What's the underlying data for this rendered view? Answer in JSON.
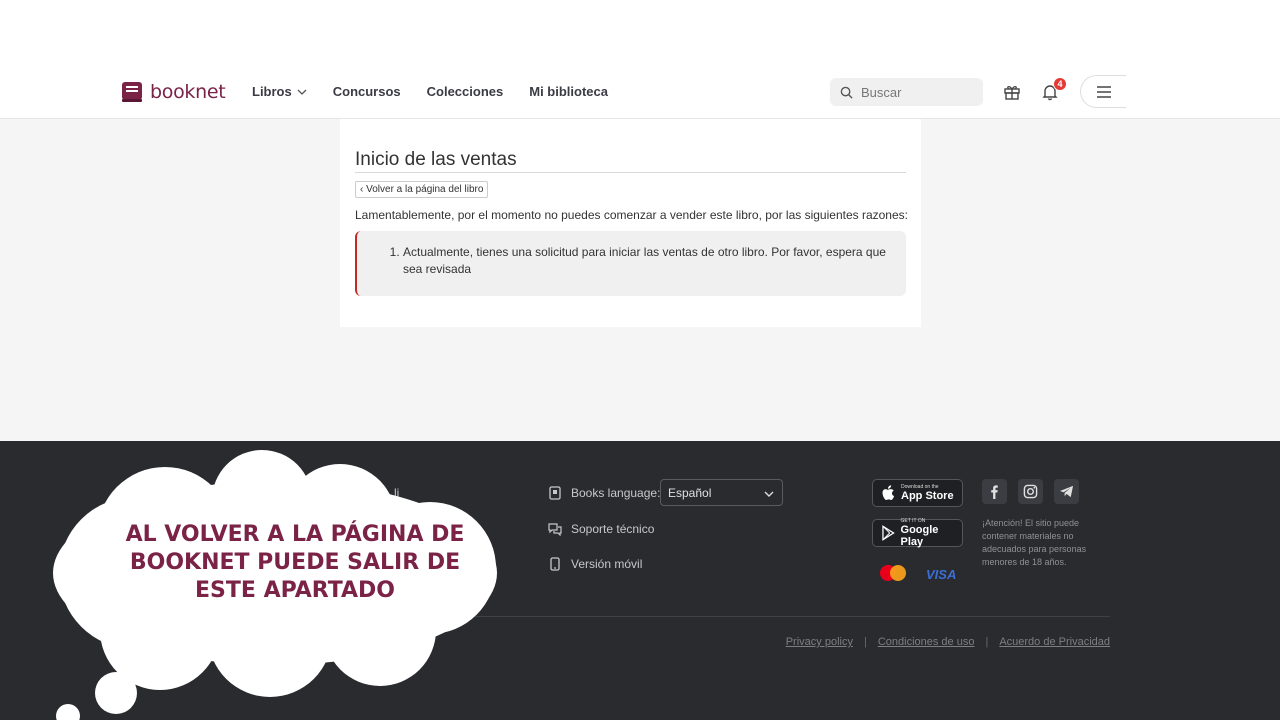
{
  "header": {
    "logo_text": "booknet",
    "nav": [
      "Libros",
      "Concursos",
      "Colecciones",
      "Mi biblioteca"
    ],
    "search_placeholder": "Buscar",
    "notification_count": "4"
  },
  "main": {
    "title": "Inicio de las ventas",
    "back_label": "‹ Volver a la página del libro",
    "intro": "Lamentablemente, por el momento no puedes comenzar a vender este libro, por las siguientes razones:",
    "reasons": [
      "Actualmente, tienes una solicitud para iniciar las ventas de otro libro. Por favor, espera que sea revisada"
    ]
  },
  "footer": {
    "partial_text": "li",
    "books_language_label": "Books language:",
    "language_value": "Español",
    "support": "Soporte técnico",
    "mobile": "Versión móvil",
    "app_store_small": "Download on the",
    "app_store": "App Store",
    "google_play_small": "GET IT ON",
    "google_play": "Google Play",
    "visa": "VISA",
    "warning": "¡Atención! El sitio puede contener materiales no adecuados para personas menores de 18 años.",
    "links": [
      "Privacy policy",
      "Condiciones de uso",
      "Acuerdo de Privacidad"
    ]
  },
  "overlay": {
    "bubble_text": "AL VOLVER A LA PÁGINA DE BOOKNET PUEDE SALIR DE ESTE APARTADO"
  },
  "colors": {
    "brand": "#7b2347",
    "alert_border": "#c62828",
    "footer_bg": "#2a2b2f"
  }
}
